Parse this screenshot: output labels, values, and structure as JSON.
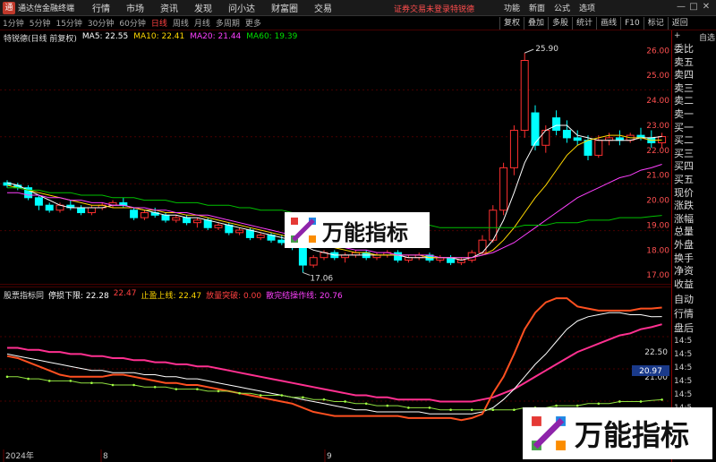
{
  "titlebar": {
    "app_title": "通达信金融终端",
    "menu": [
      "行情",
      "市场",
      "资讯",
      "发现",
      "问小达",
      "财富圈",
      "交易"
    ],
    "login_status": "证券交易未登录",
    "feature": "特锐德",
    "right_buttons": [
      "功能",
      "新面",
      "公式",
      "选项"
    ],
    "window_controls": [
      "—",
      "□",
      "✕"
    ]
  },
  "toolbar": {
    "periods": [
      "1分钟",
      "5分钟",
      "15分钟",
      "30分钟",
      "60分钟",
      "日线",
      "周线",
      "月线",
      "多周期",
      "更多"
    ],
    "active_period": "日线",
    "right_buttons": [
      "复权",
      "叠加",
      "多股",
      "统计",
      "画线",
      "F10",
      "标记",
      "返回"
    ]
  },
  "main_panel": {
    "title": "特锐德(日线 前复权)",
    "ma5": "MA5: 22.55",
    "ma10": "MA10: 22.41",
    "ma20": "MA20: 21.44",
    "ma60": "MA60: 19.39",
    "high_label": "25.90",
    "low_label": "17.06",
    "price_axis": [
      "26.00",
      "25.00",
      "24.00",
      "23.00",
      "22.00",
      "21.00",
      "20.00",
      "19.00",
      "18.00",
      "17.00"
    ]
  },
  "indicator_panel": {
    "name": "股票指标同",
    "v1": "停损下限: 22.28",
    "v2": "22.47",
    "v3": "止盈上线: 22.47",
    "v4": "放量突破: 0.00",
    "v5": "散完结操作线: 20.76",
    "current_value": "20.97",
    "axis": [
      "22.50",
      "21.00"
    ]
  },
  "date_axis": [
    "2024年",
    "8",
    "9"
  ],
  "sidebar": {
    "top_icon": "+",
    "top_label": "自选",
    "order_labels": [
      "委比",
      "卖五",
      "卖四",
      "卖三",
      "卖二",
      "卖一",
      "买一",
      "买二",
      "买三",
      "买四",
      "买五",
      "现价",
      "涨跌",
      "涨幅",
      "总量",
      "外盘",
      "换手",
      "净资",
      "收益"
    ],
    "lower_labels": [
      "自动",
      "行情",
      "盘后"
    ],
    "times": [
      "14:5",
      "14:5",
      "14:5",
      "14:5",
      "14:5",
      "14:5",
      "14:5",
      "14:5",
      "14:5"
    ]
  },
  "watermark": {
    "text": "万能指标"
  },
  "colors": {
    "up": "#ff3030",
    "down": "#00ffff",
    "ma5": "#ffffff",
    "ma10": "#ffd700",
    "ma20": "#ff40ff",
    "ma60": "#00c000",
    "grid": "#4a0000"
  },
  "chart_data": {
    "type": "candlestick",
    "candles": [
      [
        20.7,
        20.8,
        20.5,
        20.6
      ],
      [
        20.6,
        20.7,
        20.4,
        20.5
      ],
      [
        20.5,
        20.6,
        20.0,
        20.1
      ],
      [
        20.1,
        20.2,
        19.6,
        19.8
      ],
      [
        19.8,
        19.9,
        19.5,
        19.6
      ],
      [
        19.6,
        19.9,
        19.5,
        19.8
      ],
      [
        19.8,
        20.0,
        19.6,
        19.7
      ],
      [
        19.7,
        19.8,
        19.4,
        19.5
      ],
      [
        19.5,
        19.8,
        19.4,
        19.7
      ],
      [
        19.7,
        19.9,
        19.6,
        19.8
      ],
      [
        19.8,
        20.0,
        19.7,
        19.9
      ],
      [
        19.9,
        20.1,
        19.7,
        19.8
      ],
      [
        19.6,
        19.7,
        19.2,
        19.3
      ],
      [
        19.3,
        19.6,
        19.2,
        19.5
      ],
      [
        19.5,
        19.7,
        19.3,
        19.4
      ],
      [
        19.4,
        19.5,
        19.1,
        19.2
      ],
      [
        19.2,
        19.4,
        19.1,
        19.3
      ],
      [
        19.3,
        19.4,
        19.0,
        19.1
      ],
      [
        19.1,
        19.3,
        18.9,
        19.2
      ],
      [
        19.2,
        19.3,
        18.8,
        18.9
      ],
      [
        18.9,
        19.1,
        18.8,
        19.0
      ],
      [
        19.0,
        19.1,
        18.6,
        18.7
      ],
      [
        18.7,
        18.9,
        18.6,
        18.8
      ],
      [
        18.8,
        18.9,
        18.4,
        18.5
      ],
      [
        18.5,
        18.7,
        18.4,
        18.6
      ],
      [
        18.6,
        18.7,
        18.3,
        18.4
      ],
      [
        18.4,
        18.6,
        18.2,
        18.3
      ],
      [
        18.3,
        18.4,
        18.0,
        18.1
      ],
      [
        18.1,
        18.2,
        17.1,
        17.4
      ],
      [
        17.4,
        17.8,
        17.3,
        17.7
      ],
      [
        17.7,
        18.0,
        17.6,
        17.9
      ],
      [
        17.9,
        18.0,
        17.6,
        17.7
      ],
      [
        17.7,
        17.9,
        17.5,
        17.8
      ],
      [
        17.8,
        18.0,
        17.7,
        17.9
      ],
      [
        17.9,
        18.0,
        17.6,
        17.7
      ],
      [
        17.7,
        17.9,
        17.6,
        17.8
      ],
      [
        17.8,
        18.0,
        17.7,
        17.9
      ],
      [
        17.9,
        18.0,
        17.5,
        17.6
      ],
      [
        17.6,
        17.8,
        17.5,
        17.7
      ],
      [
        17.7,
        17.9,
        17.6,
        17.8
      ],
      [
        17.8,
        17.9,
        17.5,
        17.6
      ],
      [
        17.6,
        17.8,
        17.5,
        17.7
      ],
      [
        17.7,
        17.8,
        17.4,
        17.5
      ],
      [
        17.5,
        17.7,
        17.4,
        17.6
      ],
      [
        17.6,
        18.0,
        17.5,
        17.9
      ],
      [
        17.9,
        18.6,
        17.8,
        18.4
      ],
      [
        18.4,
        19.8,
        18.3,
        19.6
      ],
      [
        19.6,
        21.5,
        19.4,
        21.3
      ],
      [
        21.3,
        23.0,
        21.0,
        22.8
      ],
      [
        22.8,
        25.9,
        22.5,
        25.6
      ],
      [
        23.5,
        23.8,
        22.0,
        22.2
      ],
      [
        22.2,
        23.0,
        21.9,
        22.8
      ],
      [
        23.3,
        23.6,
        22.6,
        22.8
      ],
      [
        22.8,
        23.2,
        22.3,
        22.5
      ],
      [
        22.5,
        22.8,
        22.2,
        22.4
      ],
      [
        22.4,
        22.6,
        21.6,
        21.8
      ],
      [
        21.8,
        22.6,
        21.7,
        22.4
      ],
      [
        22.4,
        22.7,
        22.2,
        22.5
      ],
      [
        22.5,
        22.8,
        22.2,
        22.4
      ],
      [
        22.4,
        22.7,
        22.3,
        22.6
      ],
      [
        22.6,
        22.9,
        22.4,
        22.5
      ],
      [
        22.5,
        22.8,
        22.1,
        22.3
      ],
      [
        22.3,
        22.7,
        22.1,
        22.55
      ]
    ],
    "ylim": [
      16.9,
      26.3
    ],
    "ma": {
      "ma5": [
        20.7,
        20.6,
        20.4,
        20.2,
        20.0,
        19.8,
        19.7,
        19.7,
        19.7,
        19.7,
        19.8,
        19.8,
        19.7,
        19.6,
        19.5,
        19.4,
        19.4,
        19.3,
        19.3,
        19.2,
        19.1,
        19.0,
        18.9,
        18.8,
        18.7,
        18.6,
        18.5,
        18.4,
        18.2,
        18.0,
        17.9,
        17.8,
        17.8,
        17.8,
        17.8,
        17.8,
        17.8,
        17.8,
        17.7,
        17.7,
        17.7,
        17.7,
        17.7,
        17.6,
        17.7,
        17.9,
        18.4,
        19.2,
        20.3,
        21.5,
        22.3,
        22.8,
        23.0,
        23.0,
        22.6,
        22.5,
        22.4,
        22.4,
        22.4,
        22.4,
        22.5,
        22.5,
        22.55
      ],
      "ma10": [
        20.6,
        20.5,
        20.4,
        20.3,
        20.2,
        20.1,
        20.0,
        19.9,
        19.8,
        19.8,
        19.7,
        19.7,
        19.7,
        19.6,
        19.6,
        19.5,
        19.5,
        19.4,
        19.4,
        19.3,
        19.2,
        19.1,
        19.0,
        18.9,
        18.8,
        18.7,
        18.6,
        18.5,
        18.4,
        18.3,
        18.2,
        18.1,
        18.0,
        17.9,
        17.9,
        17.8,
        17.8,
        17.8,
        17.8,
        17.8,
        17.7,
        17.7,
        17.7,
        17.7,
        17.7,
        17.8,
        18.0,
        18.4,
        18.9,
        19.5,
        20.1,
        20.6,
        21.2,
        21.8,
        22.2,
        22.4,
        22.5,
        22.6,
        22.6,
        22.5,
        22.5,
        22.4,
        22.41
      ],
      "ma20": [
        20.3,
        20.3,
        20.2,
        20.2,
        20.1,
        20.1,
        20.0,
        20.0,
        19.9,
        19.9,
        19.8,
        19.8,
        19.7,
        19.7,
        19.6,
        19.6,
        19.5,
        19.5,
        19.4,
        19.4,
        19.3,
        19.2,
        19.1,
        19.0,
        18.9,
        18.8,
        18.7,
        18.6,
        18.5,
        18.4,
        18.3,
        18.2,
        18.1,
        18.0,
        18.0,
        17.9,
        17.9,
        17.8,
        17.8,
        17.8,
        17.8,
        17.7,
        17.7,
        17.7,
        17.7,
        17.8,
        17.9,
        18.1,
        18.3,
        18.6,
        18.9,
        19.2,
        19.5,
        19.8,
        20.1,
        20.3,
        20.5,
        20.7,
        20.9,
        21.0,
        21.2,
        21.3,
        21.44
      ],
      "ma60": [
        20.5,
        20.5,
        20.4,
        20.4,
        20.3,
        20.3,
        20.3,
        20.2,
        20.2,
        20.2,
        20.1,
        20.1,
        20.1,
        20.0,
        20.0,
        20.0,
        19.9,
        19.9,
        19.9,
        19.8,
        19.8,
        19.8,
        19.7,
        19.7,
        19.6,
        19.6,
        19.6,
        19.5,
        19.5,
        19.4,
        19.4,
        19.3,
        19.3,
        19.2,
        19.2,
        19.1,
        19.1,
        19.1,
        19.0,
        19.0,
        19.0,
        18.9,
        18.9,
        18.9,
        18.9,
        18.9,
        18.9,
        18.9,
        18.9,
        19.0,
        19.0,
        19.0,
        19.1,
        19.1,
        19.1,
        19.2,
        19.2,
        19.2,
        19.3,
        19.3,
        19.3,
        19.35,
        19.39
      ]
    }
  }
}
